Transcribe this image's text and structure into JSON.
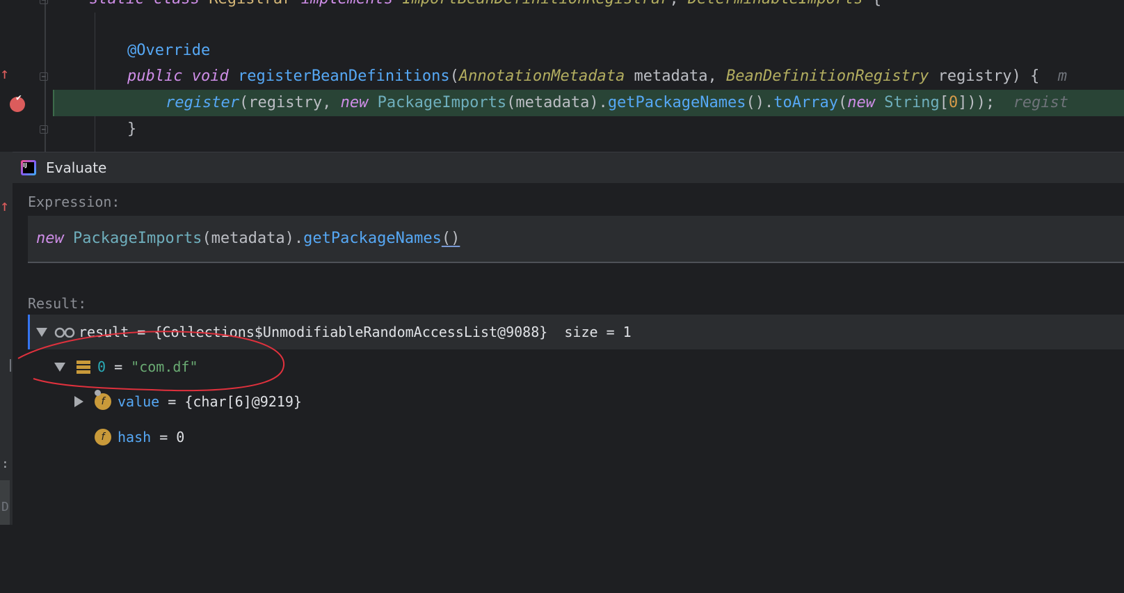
{
  "editor": {
    "line1": {
      "static": "static",
      "class": "class",
      "name": "Registrar",
      "implements": "implements",
      "iface1": "ImportBeanDefinitionRegistrar",
      "comma": ",",
      "iface2": "DeterminableImports",
      "brace": "{"
    },
    "line2": {
      "annotation": "@Override"
    },
    "line3": {
      "public": "public",
      "void": "void",
      "method": "registerBeanDefinitions",
      "open": "(",
      "type1": "AnnotationMetadata",
      "param1": " metadata, ",
      "type2": "BeanDefinitionRegistry",
      "param2": " registry) {  ",
      "hint": "m"
    },
    "line4": {
      "register": "register",
      "args1": "(registry, ",
      "new1": "new",
      "cls": "PackageImports",
      "args2": "(metadata).",
      "getPkg": "getPackageNames",
      "args3": "().",
      "toArray": "toArray",
      "args4": "(",
      "new2": "new",
      "string": "String",
      "bracket1": "[",
      "zero": "0",
      "bracket2": "]));  ",
      "hint": "regist"
    },
    "line5": {
      "close": "}"
    }
  },
  "dialog": {
    "title": "Evaluate",
    "expression_label": "Expression:",
    "expression": {
      "new": "new",
      "cls": "PackageImports",
      "args": "(metadata).",
      "method": "getPackageNames",
      "parens": "()"
    },
    "result_label": "Result:",
    "tree": {
      "root": {
        "name": "result",
        "eq": " = ",
        "value": "{Collections$UnmodifiableRandomAccessList@9088}",
        "size": "  size = 1"
      },
      "item0": {
        "index": "0",
        "eq": " = ",
        "value": "\"com.df\""
      },
      "field_value": {
        "icon": "f",
        "name": "value",
        "eq": " = ",
        "value": "{char[6]@9219}"
      },
      "field_hash": {
        "icon": "f",
        "name": "hash",
        "eq": " = ",
        "value": "0"
      }
    }
  },
  "left_strip": {
    "glyph1": ":",
    "glyph2": "D"
  },
  "colors": {
    "highlight_line": "#294436",
    "annotation_circle": "#e0313d",
    "breakpoint": "#db5c5c",
    "accent": "#3574f0"
  }
}
